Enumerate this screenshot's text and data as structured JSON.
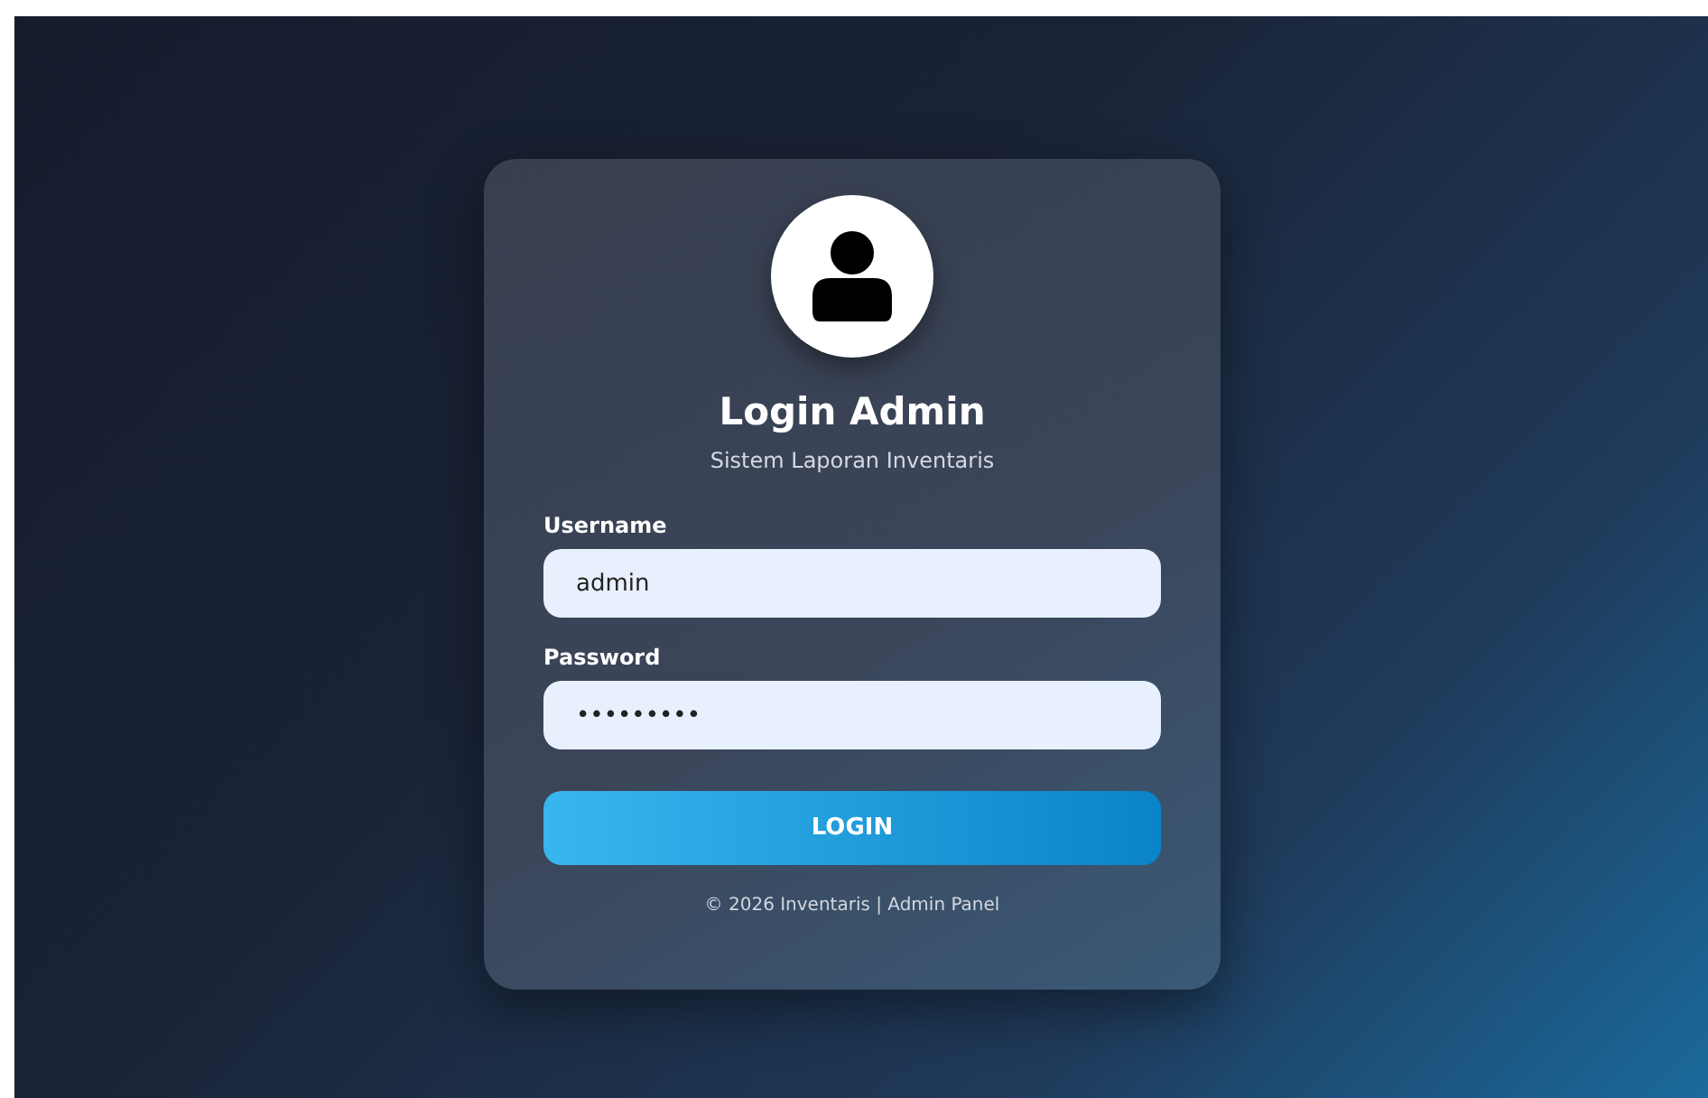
{
  "card": {
    "title": "Login Admin",
    "subtitle": "Sistem Laporan Inventaris",
    "fields": [
      {
        "label": "Username",
        "value": "admin"
      },
      {
        "label": "Password",
        "value": "•••••••••"
      }
    ],
    "button": "LOGIN",
    "footer": "© 2026 Inventaris | Admin Panel"
  }
}
